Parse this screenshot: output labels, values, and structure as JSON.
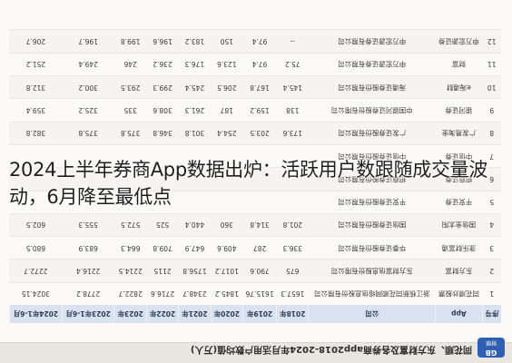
{
  "table": {
    "logo_text": "GB",
    "logo_subtext": "财联",
    "title": "同花顺、东方财富及各券商app2018-2024年月活用户数均值(万人)",
    "headers": [
      "序号",
      "App",
      "公司",
      "2018年",
      "2019年",
      "2020年",
      "2021年",
      "2022年",
      "2023年",
      "2023年1-6月",
      "2024年1-6月"
    ],
    "rows": [
      [
        "1",
        "同花顺炒股票",
        "浙江核新同花顺网络信息股份有限公司",
        "1657.3",
        "1615.76",
        "1845.2",
        "2348.7",
        "2716.6",
        "2822.7",
        "2778.2",
        "3024.15"
      ],
      [
        "2",
        "东方财富",
        "东方财富信息股份有限公司",
        "675",
        "790.6",
        "1017.2",
        "1756.8",
        "2115",
        "2214.5",
        "2216.4",
        "2272.7"
      ],
      [
        "3",
        "涨乐财富通",
        "华泰证券股份有限公司",
        "336.3",
        "287",
        "409.6",
        "647.9",
        "709.8",
        "664.3",
        "683.9",
        "680.5"
      ],
      [
        "4",
        "国信金太阳",
        "国信证券股份有限公司",
        "201.8",
        "314.8",
        "360",
        "440.4",
        "525",
        "572.5",
        "555.3",
        "602.5"
      ],
      [
        "5",
        "平安证券",
        "平安证券股份有限公司",
        "",
        "",
        "",
        "",
        "",
        "",
        "",
        ""
      ],
      [
        "6",
        "招商证券",
        "招商证券股份有限公司",
        "",
        "",
        "",
        "",
        "",
        "",
        "",
        ""
      ],
      [
        "7",
        "中信证券",
        "中信证券股份有限公司",
        "",
        "",
        "",
        "",
        "",
        "",
        "",
        ""
      ],
      [
        "8",
        "广发易淘金",
        "广发证券股份有限公司",
        "173.6",
        "203.5",
        "254.4",
        "301.8",
        "346.8",
        "375.8",
        "375.8",
        "382.8"
      ],
      [
        "9",
        "银河证券",
        "中国银河证券股份有限公司",
        "138",
        "159.2",
        "187",
        "261.3",
        "308.6",
        "335",
        "325.2",
        "359.4"
      ],
      [
        "10",
        "e海通财",
        "海通证券股份有限公司",
        "145.4",
        "167.8",
        "206.5",
        "245.4",
        "299.3",
        "293.5",
        "300.2",
        "312.8"
      ],
      [
        "11",
        "财富",
        "申万宏源证券有限公司",
        "75.2",
        "97.4",
        "123.6",
        "176.3",
        "236.2",
        "246",
        "249.4",
        "251.2"
      ],
      [
        "12",
        "申万宏源证券",
        "申万宏源证券有限公司",
        "--",
        "97.4",
        "150",
        "183.2",
        "196.6",
        "199.8",
        "196.7",
        "206.7"
      ]
    ]
  },
  "headline": "2024上半年券商App数据出炉：活跃用户数跟随成交量波动，6月降至最低点"
}
